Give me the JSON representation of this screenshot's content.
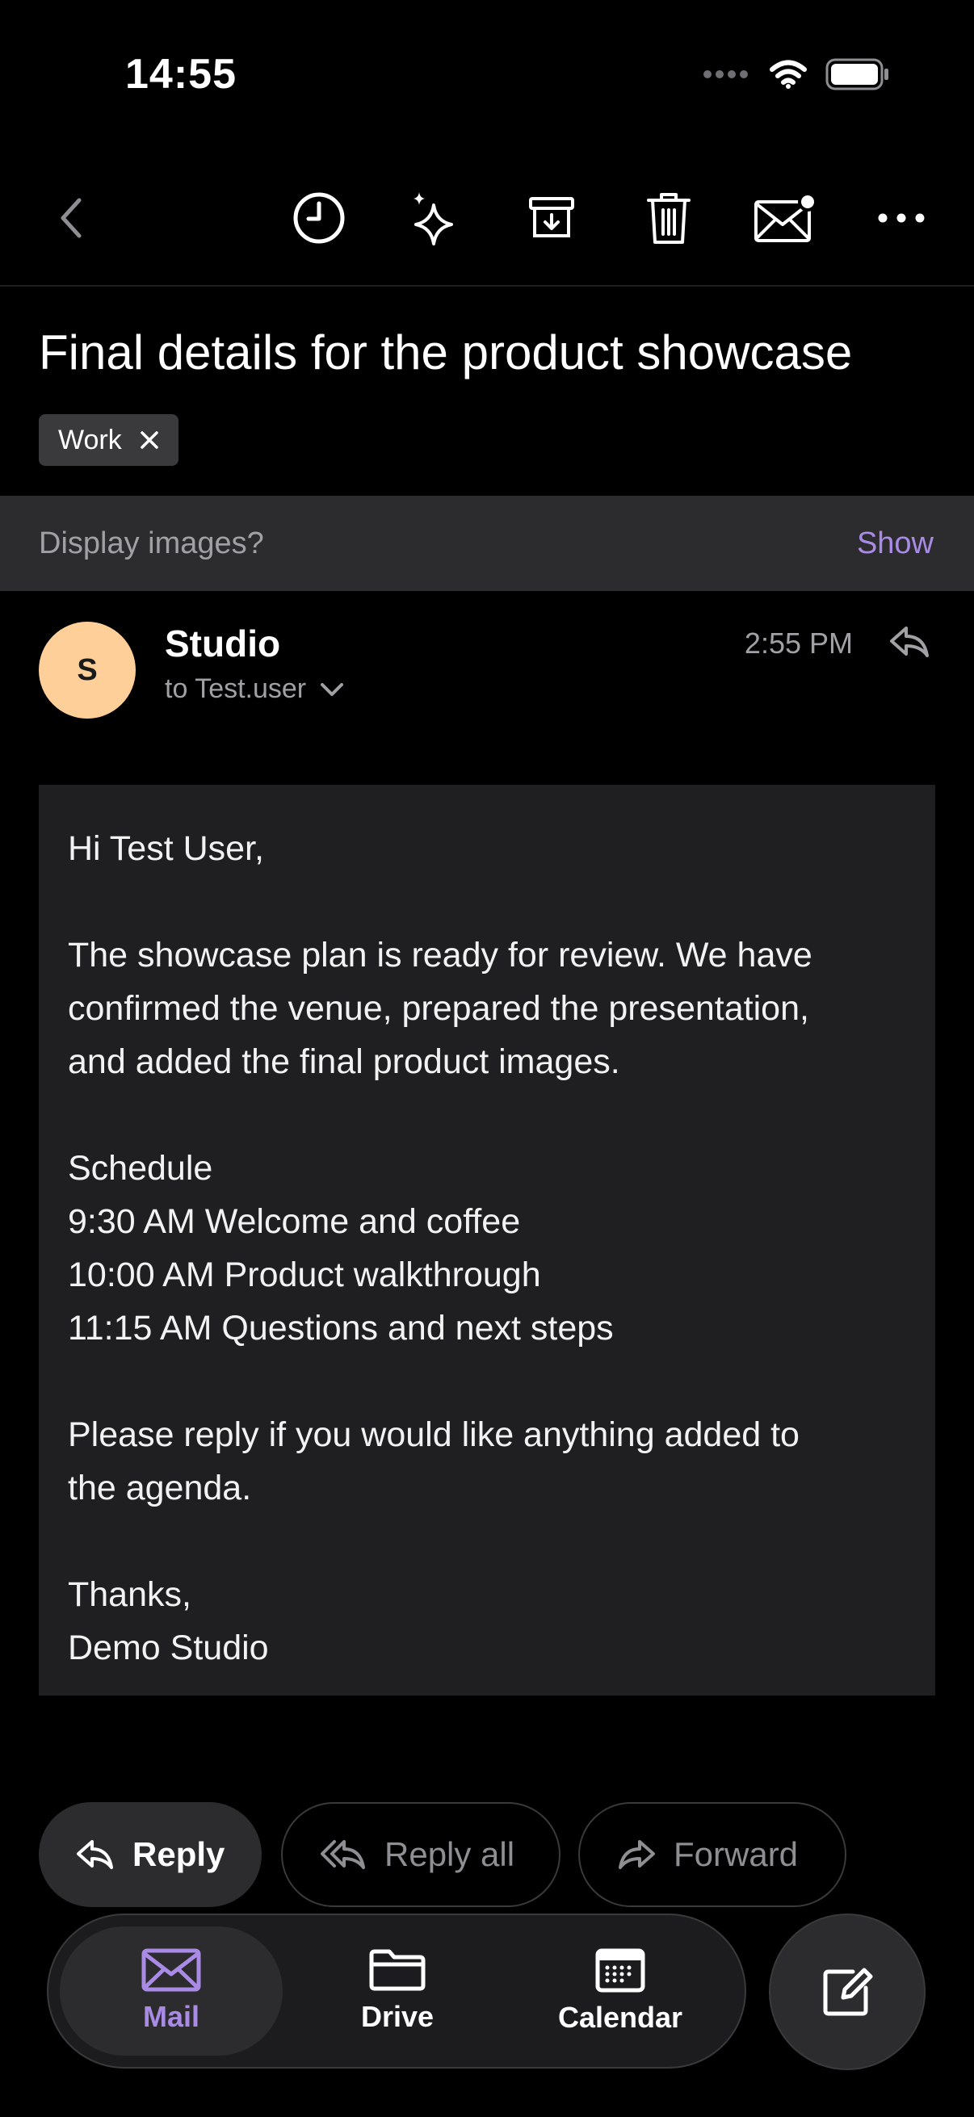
{
  "status_bar": {
    "time": "14:55"
  },
  "email": {
    "subject": "Final details for the product showcase",
    "tag": "Work",
    "images_prompt": "Display images?",
    "images_action": "Show",
    "sender_initial": "S",
    "sender_name": "Studio",
    "recipient": "to Test.user",
    "time": "2:55 PM",
    "body": {
      "greeting": "Hi Test User,",
      "para1_line1": "The showcase plan is ready for review. We have",
      "para1_line2": "confirmed the venue, prepared the presentation,",
      "para1_line3": "and added the final product images.",
      "schedule_title": "Schedule",
      "schedule_1": "9:30 AM  Welcome and coffee",
      "schedule_2": "10:00 AM  Product walkthrough",
      "schedule_3": "11:15 AM  Questions and next steps",
      "para2_line1": "Please reply if you would like anything added to",
      "para2_line2": "the agenda.",
      "signoff": "Thanks,",
      "signature": "Demo Studio"
    }
  },
  "actions": {
    "reply": "Reply",
    "reply_all": "Reply all",
    "forward": "Forward"
  },
  "tabs": {
    "mail": "Mail",
    "drive": "Drive",
    "calendar": "Calendar"
  },
  "colors": {
    "accent": "#a98be6",
    "avatar": "#ffcf9a",
    "background": "#000000",
    "card": "#1f1f21"
  }
}
